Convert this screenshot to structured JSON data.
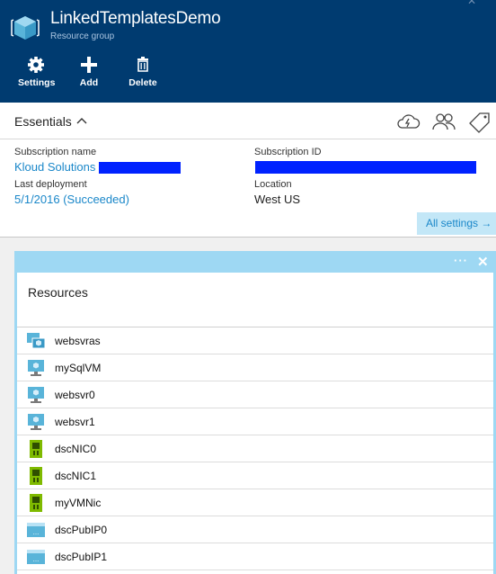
{
  "header": {
    "title": "LinkedTemplatesDemo",
    "subtitle": "Resource group",
    "commands": [
      {
        "label": "Settings",
        "icon": "gear-icon"
      },
      {
        "label": "Add",
        "icon": "plus-icon"
      },
      {
        "label": "Delete",
        "icon": "trash-icon"
      }
    ],
    "colors": {
      "background": "#003b70"
    }
  },
  "essentials": {
    "title": "Essentials",
    "subscription_name_label": "Subscription name",
    "subscription_name_value": "Kloud Solutions",
    "subscription_id_label": "Subscription ID",
    "last_deployment_label": "Last deployment",
    "last_deployment_value": "5/1/2016 (Succeeded)",
    "location_label": "Location",
    "location_value": "West US",
    "all_settings": "All settings →",
    "colors": {
      "link": "#1a87c9",
      "redaction": "#0022ff"
    }
  },
  "resources": {
    "title": "Resources",
    "items": [
      {
        "name": "websvras",
        "icon": "availability-set-icon"
      },
      {
        "name": "mySqlVM",
        "icon": "virtual-machine-icon"
      },
      {
        "name": "websvr0",
        "icon": "virtual-machine-icon"
      },
      {
        "name": "websvr1",
        "icon": "virtual-machine-icon"
      },
      {
        "name": "dscNIC0",
        "icon": "network-interface-icon"
      },
      {
        "name": "dscNIC1",
        "icon": "network-interface-icon"
      },
      {
        "name": "myVMNic",
        "icon": "network-interface-icon"
      },
      {
        "name": "dscPubIP0",
        "icon": "public-ip-icon"
      },
      {
        "name": "dscPubIP1",
        "icon": "public-ip-icon"
      }
    ],
    "colors": {
      "tile": "#9ed8f3"
    }
  }
}
